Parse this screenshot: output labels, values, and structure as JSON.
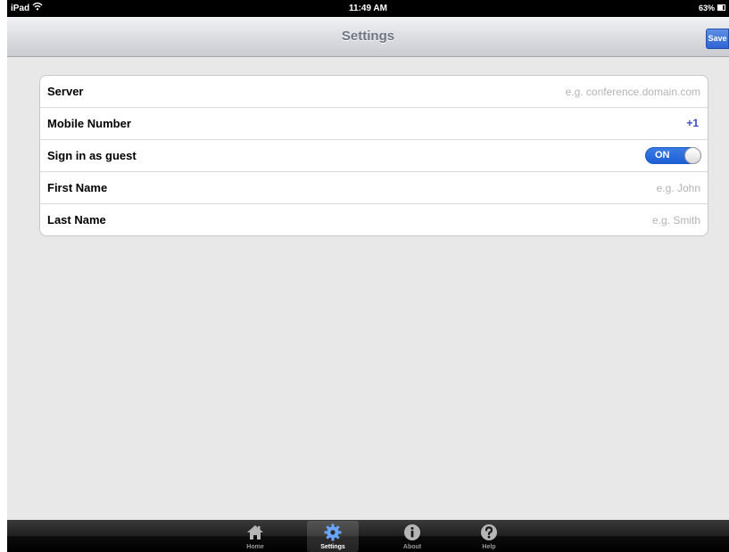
{
  "status_bar": {
    "carrier": "iPad",
    "time": "11:49 AM",
    "battery": "63%"
  },
  "nav": {
    "title": "Settings",
    "save_label": "Save"
  },
  "form": {
    "server": {
      "label": "Server",
      "placeholder": "e.g. conference.domain.com",
      "value": ""
    },
    "mobile": {
      "label": "Mobile Number",
      "value": "+1"
    },
    "guest": {
      "label": "Sign in as guest",
      "toggle_text": "ON",
      "on": true
    },
    "first_name": {
      "label": "First Name",
      "placeholder": "e.g. John",
      "value": ""
    },
    "last_name": {
      "label": "Last Name",
      "placeholder": "e.g. Smith",
      "value": ""
    }
  },
  "tabs": [
    {
      "label": "Home",
      "icon": "home-icon"
    },
    {
      "label": "Settings",
      "icon": "gear-icon",
      "selected": true
    },
    {
      "label": "About",
      "icon": "info-icon"
    },
    {
      "label": "Help",
      "icon": "help-icon"
    }
  ],
  "colors": {
    "accent_blue": "#2f64d4",
    "toggle_blue": "#1d60d4",
    "background": "#e8e8e8"
  }
}
